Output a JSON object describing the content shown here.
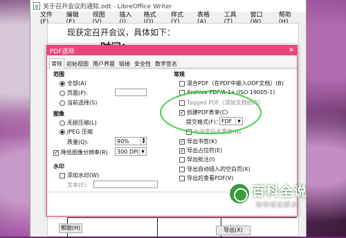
{
  "window": {
    "title": "关于召开会议的通知.odt - LibreOffice Writer"
  },
  "menu": [
    "文件(F)",
    "编辑(E)",
    "视图(V)",
    "插入(I)",
    "格式(O)",
    "样式(Y)",
    "表格(A)",
    "工具(T)",
    "窗口(W)",
    "帮助(H)"
  ],
  "document": {
    "line1": "现获定召开会议，具体如下：",
    "line2": "一、时间："
  },
  "dialog": {
    "title": "PDF选项",
    "close": "✕",
    "tabs": [
      "常规",
      "初始视图",
      "用户界面",
      "链接",
      "安全性",
      "数字签名"
    ],
    "range": {
      "heading": "范围",
      "all": "全部(A)",
      "pages": "页面(P):",
      "pages_value": "",
      "selection": "当前选择(S)"
    },
    "image": {
      "heading": "图像",
      "lossless": "无损压缩(L)",
      "jpeg": "JPEG 压缩",
      "quality_label": "质量(Q):",
      "quality_value": "90%",
      "reduce_label": "降低图像分辨率(R)",
      "reduce_value": "300 DPI"
    },
    "watermark": {
      "heading": "水印",
      "add": "添加水印(W)",
      "text_label": "文本(E):",
      "text_value": ""
    },
    "general": {
      "heading": "常规",
      "hybrid": "混合PDF（在PDF中嵌入ODF文档）(B)",
      "archive": "Archive PDF/A-1a (ISO 19005-1)",
      "tagged": "Tagged PDF（添加文档结构）",
      "create_form": "创建PDF表单(C)",
      "submit_format_label": "提交格式(F)：",
      "submit_format_value": "FDF",
      "allow_duplicate": "允许字段名重复(N)",
      "export_bookmarks": "导出书签(K)",
      "export_placeholders": "导出占位符(E)",
      "export_comments": "导出批注(I)",
      "export_blank_pages": "导出自动插入的空白页(X)",
      "export_hidden": "导出后查看PDF(V)"
    },
    "buttons": {
      "help": "帮助(H)",
      "export": "导出(X)"
    }
  },
  "watermark_logo": {
    "big": "百科全说",
    "small": "助你轻松解决"
  }
}
